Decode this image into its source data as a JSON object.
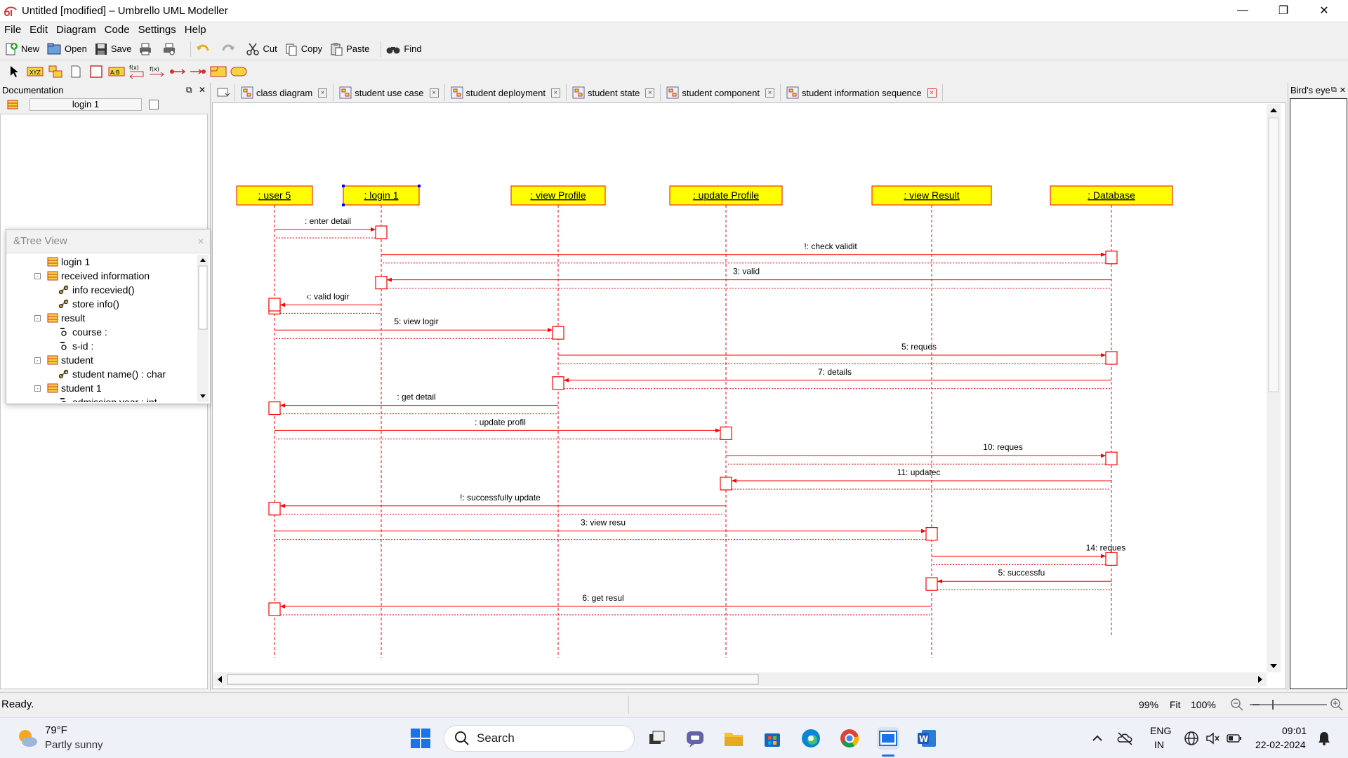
{
  "window": {
    "title": "Untitled [modified] – Umbrello UML Modeller"
  },
  "menubar": [
    "File",
    "Edit",
    "Diagram",
    "Code",
    "Settings",
    "Help"
  ],
  "toolbar": {
    "new": "New",
    "open": "Open",
    "save": "Save",
    "cut": "Cut",
    "copy": "Copy",
    "paste": "Paste",
    "find": "Find"
  },
  "documentation": {
    "title": "Documentation",
    "name": "login 1"
  },
  "tree_view": {
    "title": "&Tree View",
    "items": [
      {
        "label": "login 1",
        "icon": "class-icon",
        "depth": 1,
        "expander": ""
      },
      {
        "label": "received information",
        "icon": "class-icon",
        "depth": 1,
        "expander": "-"
      },
      {
        "label": "info recevied()",
        "icon": "operation-icon",
        "depth": 2,
        "expander": ""
      },
      {
        "label": "store info()",
        "icon": "operation-icon",
        "depth": 2,
        "expander": ""
      },
      {
        "label": "result",
        "icon": "class-icon",
        "depth": 1,
        "expander": "-"
      },
      {
        "label": "course :",
        "icon": "attribute-icon",
        "depth": 2,
        "expander": ""
      },
      {
        "label": "s-id :",
        "icon": "attribute-icon",
        "depth": 2,
        "expander": ""
      },
      {
        "label": "student",
        "icon": "class-icon",
        "depth": 1,
        "expander": "-"
      },
      {
        "label": "student name() : char",
        "icon": "operation-icon",
        "depth": 2,
        "expander": ""
      },
      {
        "label": "student 1",
        "icon": "class-icon",
        "depth": 1,
        "expander": "-"
      },
      {
        "label": "admission year : int",
        "icon": "attribute-icon",
        "depth": 2,
        "expander": ""
      }
    ]
  },
  "tabs": [
    {
      "label": "class diagram",
      "active": false
    },
    {
      "label": "student use case",
      "active": false
    },
    {
      "label": "student deployment",
      "active": false
    },
    {
      "label": "student state",
      "active": false
    },
    {
      "label": "student component",
      "active": false
    },
    {
      "label": "student information sequence",
      "active": true
    }
  ],
  "birds_eye": {
    "title": "Bird's eye"
  },
  "colors": {
    "lifeline_box": "#ffff00",
    "message": "#ff0000",
    "background": "#f0f0f0"
  },
  "sequence": {
    "objects": [
      ": user 5",
      ": login 1",
      ": view Profile",
      ": update Profile",
      ": view Result",
      ": Database"
    ],
    "messages": [
      {
        "label": ": enter detail",
        "from": 0,
        "to": 1
      },
      {
        "label": "!: check validit",
        "from": 1,
        "to": 5
      },
      {
        "label": "3: valid",
        "from": 5,
        "to": 1
      },
      {
        "label": "‹: valid logir",
        "from": 1,
        "to": 0
      },
      {
        "label": "5: view logir",
        "from": 0,
        "to": 2
      },
      {
        "label": "5: reques",
        "from": 2,
        "to": 5
      },
      {
        "label": "7: details",
        "from": 5,
        "to": 2
      },
      {
        "label": ": get detail",
        "from": 2,
        "to": 0
      },
      {
        "label": ": update profil",
        "from": 0,
        "to": 3
      },
      {
        "label": "10: reques",
        "from": 3,
        "to": 5
      },
      {
        "label": "11: updatec",
        "from": 5,
        "to": 3
      },
      {
        "label": "!: successfully update",
        "from": 3,
        "to": 0
      },
      {
        "label": "3: view resu",
        "from": 0,
        "to": 4
      },
      {
        "label": "14: reques",
        "from": 4,
        "to": 5
      },
      {
        "label": "5: successfu",
        "from": 5,
        "to": 4
      },
      {
        "label": "6: get resul",
        "from": 4,
        "to": 0
      }
    ]
  },
  "status": {
    "text": "Ready.",
    "zoom": "99%",
    "fit": "Fit",
    "hundred": "100%"
  },
  "taskbar": {
    "weather_temp": "79°F",
    "weather_desc": "Partly sunny",
    "search": "Search",
    "lang1": "ENG",
    "lang2": "IN",
    "time": "09:01",
    "date": "22-02-2024"
  }
}
